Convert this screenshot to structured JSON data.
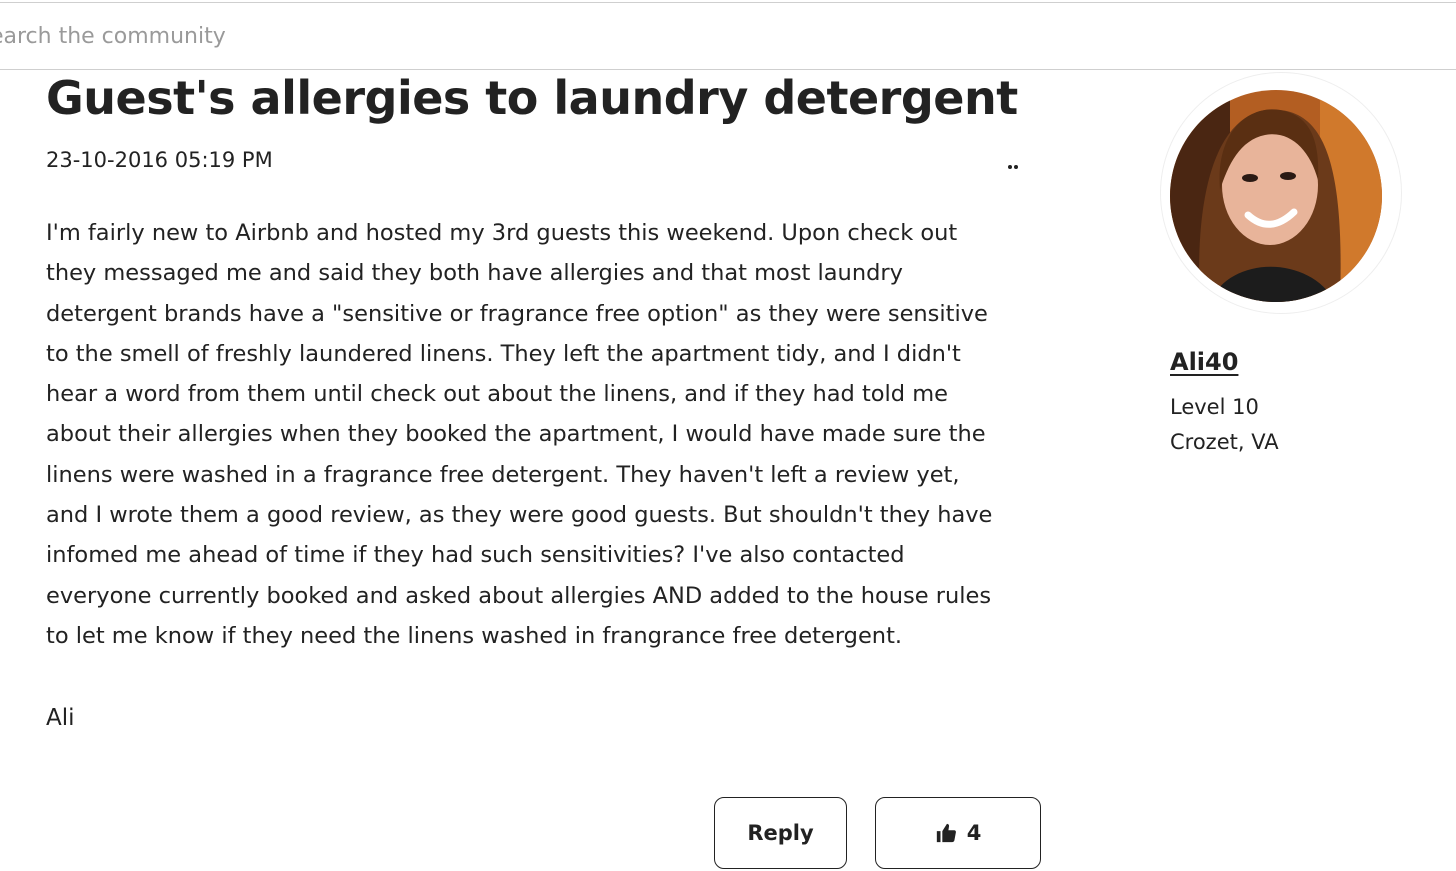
{
  "search": {
    "placeholder": "Search the community"
  },
  "post": {
    "title": "Guest's allergies to laundry detergent",
    "date": "23-10-2016 05:19 PM",
    "body_lines": [
      "I'm fairly new to Airbnb and hosted my 3rd guests this weekend. Upon check out",
      "they messaged me and said they both have allergies and that most laundry",
      "detergent brands have a \"sensitive or fragrance free option\" as they were sensitive",
      "to the smell of freshly laundered linens. They left the apartment tidy, and I didn't",
      "hear a word from them until check out about the linens, and if they had told me",
      "about their allergies when they booked the apartment, I would have made sure the",
      "linens were washed in a fragrance free detergent. They haven't left a review yet,",
      "and I wrote them a good review, as they were good guests. But shouldn't they have",
      "infomed me ahead of time if they had such sensitivities? I've also contacted",
      "everyone currently booked and asked about allergies AND added to the house rules",
      "to let me know if they need the linens washed in frangrance free detergent."
    ],
    "signature": "Ali"
  },
  "actions": {
    "reply_label": "Reply",
    "like_count": "4",
    "like_icon": "thumbs-up-icon",
    "menu_icon": "more-options-icon"
  },
  "author": {
    "name": "Ali40",
    "level": "Level 10",
    "location": "Crozet, VA"
  }
}
